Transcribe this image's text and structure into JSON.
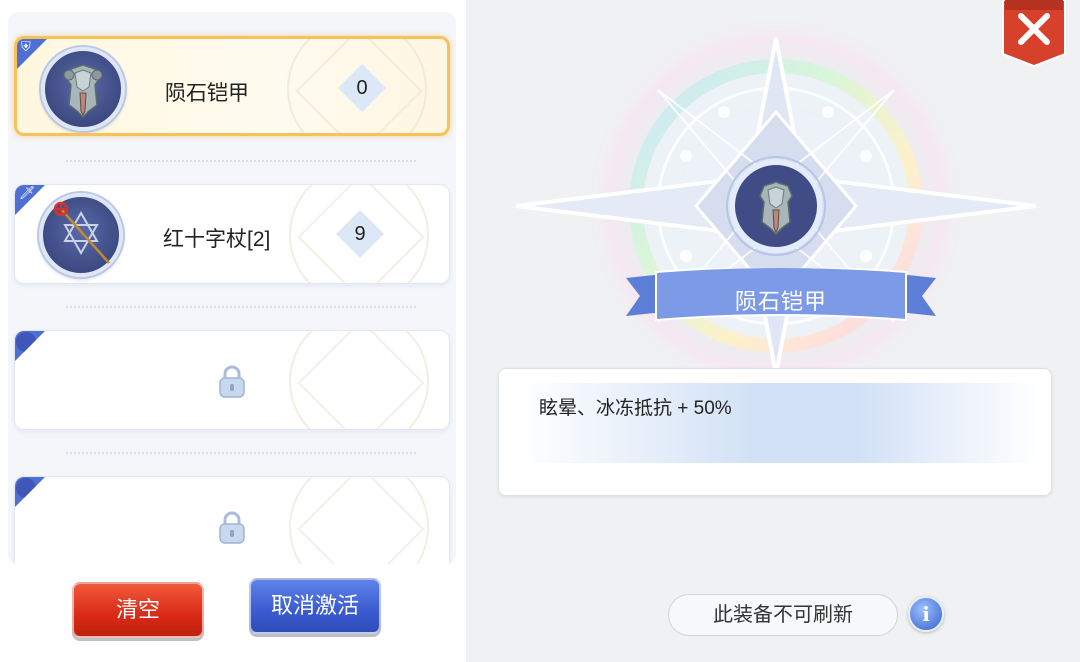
{
  "slots": [
    {
      "name": "陨石铠甲",
      "refine": "0",
      "badge_icon": "shield-icon",
      "item_icon": "armor-icon",
      "selected": true
    },
    {
      "name": "红十字杖[2]",
      "refine": "9",
      "badge_icon": "sword-icon",
      "item_icon": "staff-icon",
      "selected": false
    }
  ],
  "locked_slots": 2,
  "buttons": {
    "clear": "清空",
    "cancel_activate": "取消激活"
  },
  "preview": {
    "title": "陨石铠甲",
    "effect": "眩晕、冰冻抵抗 + 50%",
    "refresh_note": "此装备不可刷新",
    "info_label": "i"
  },
  "colors": {
    "accent_blue": "#4f6fd3",
    "accent_red": "#d92a17",
    "selected_gold": "#f6c35a"
  }
}
